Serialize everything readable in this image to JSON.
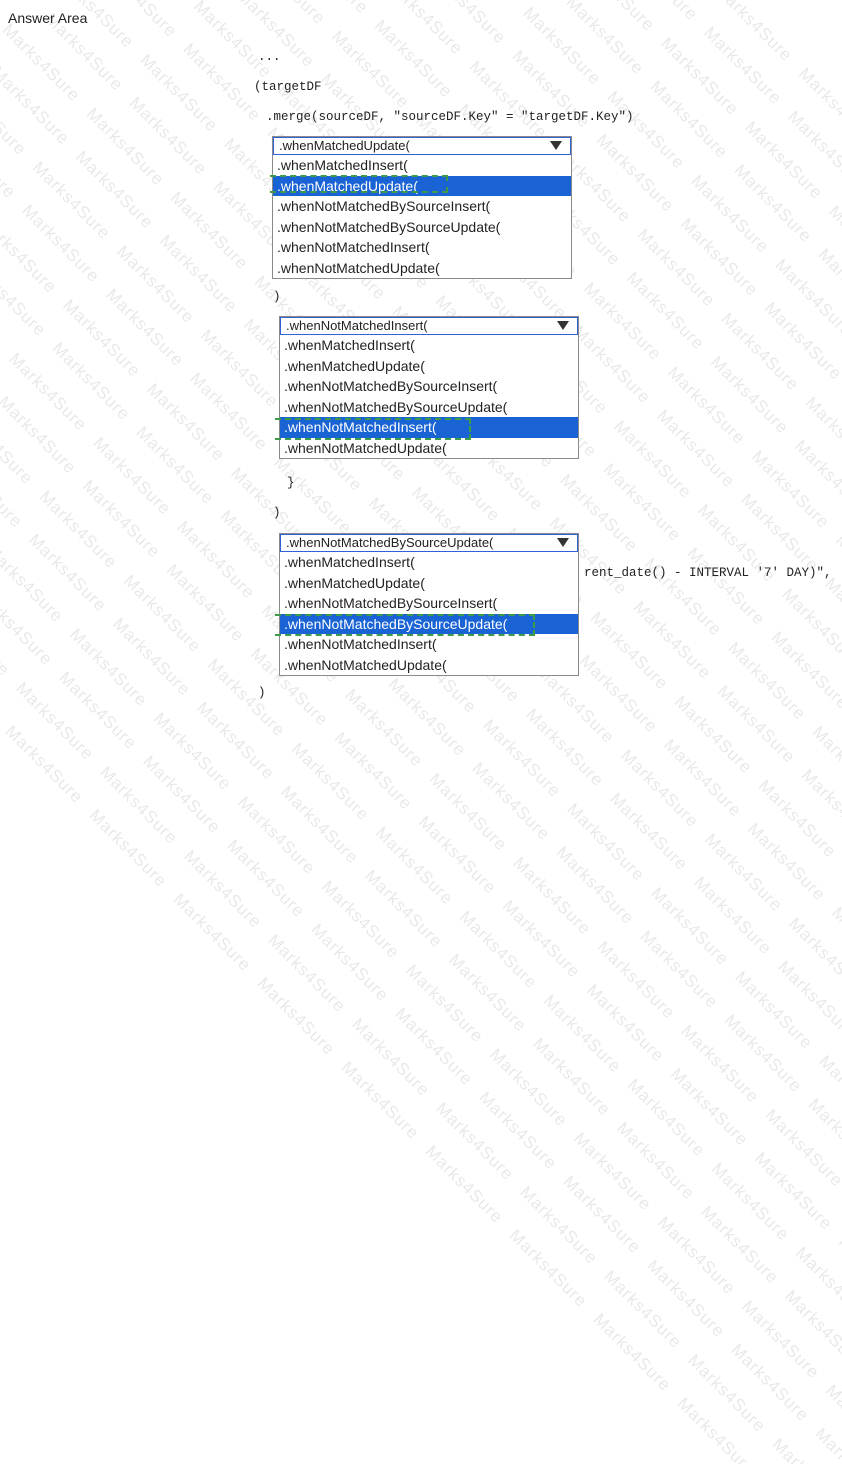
{
  "answer_area": {
    "title": "Answer Area"
  },
  "watermark": {
    "text": "Marks4Sure"
  },
  "code": {
    "ellipsis": "...",
    "target_open": "(targetDF",
    "merge_line": ".merge(sourceDF, \"sourceDF.Key\" = \"targetDF.Key\")",
    "paren_1": ")",
    "paren_2": ")",
    "brace_1": "}",
    "paren_3": ")",
    "partial_condition": "rent_date() - INTERVAL '7' DAY)\",",
    "paren_4": ")"
  },
  "dropdowns": [
    {
      "selected": ".whenMatchedUpdate(",
      "options": [
        {
          "label": ".whenMatchedInsert("
        },
        {
          "label": ".whenMatchedUpdate("
        },
        {
          "label": ".whenNotMatchedBySourceInsert("
        },
        {
          "label": ".whenNotMatchedBySourceUpdate("
        },
        {
          "label": ".whenNotMatchedInsert("
        },
        {
          "label": ".whenNotMatchedUpdate("
        }
      ],
      "highlighted_index": 1
    },
    {
      "selected": ".whenNotMatchedInsert(",
      "options": [
        {
          "label": ".whenMatchedInsert("
        },
        {
          "label": ".whenMatchedUpdate("
        },
        {
          "label": ".whenNotMatchedBySourceInsert("
        },
        {
          "label": ".whenNotMatchedBySourceUpdate("
        },
        {
          "label": ".whenNotMatchedInsert("
        },
        {
          "label": ".whenNotMatchedUpdate("
        }
      ],
      "highlighted_index": 4
    },
    {
      "selected": ".whenNotMatchedBySourceUpdate(",
      "options": [
        {
          "label": ".whenMatchedInsert("
        },
        {
          "label": ".whenMatchedUpdate("
        },
        {
          "label": ".whenNotMatchedBySourceInsert("
        },
        {
          "label": ".whenNotMatchedBySourceUpdate("
        },
        {
          "label": ".whenNotMatchedInsert("
        },
        {
          "label": ".whenNotMatchedUpdate("
        }
      ],
      "highlighted_index": 3
    }
  ],
  "colors": {
    "highlight": "#1a63d4",
    "select_border": "#2f62d8",
    "answer_dash": "#3d9b4a"
  }
}
